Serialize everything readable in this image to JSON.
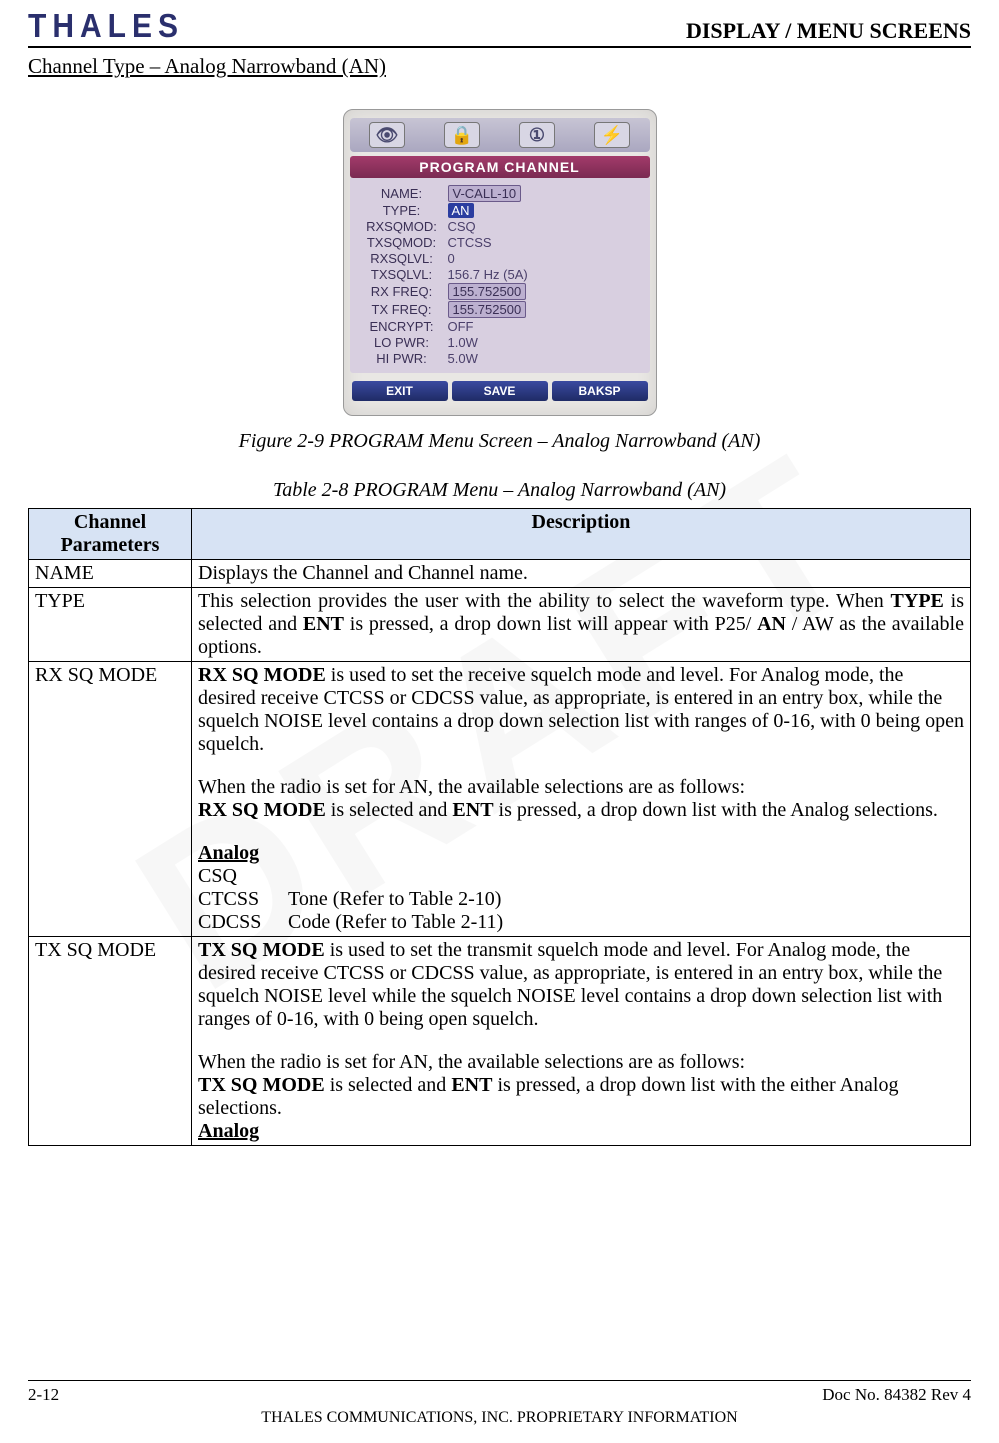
{
  "header": {
    "brand": "THALES",
    "right": "DISPLAY / MENU SCREENS"
  },
  "section_title": "Channel Type – Analog Narrowband (AN)",
  "device": {
    "title": "PROGRAM CHANNEL",
    "iconbar": [
      "👁",
      "🔒",
      "①",
      "⚡"
    ],
    "rows": [
      {
        "label": "NAME:",
        "value": "V-CALL-10",
        "boxed": true
      },
      {
        "label": "TYPE:",
        "value": "AN",
        "selected": true
      },
      {
        "label": "RXSQMOD:",
        "value": "CSQ"
      },
      {
        "label": "TXSQMOD:",
        "value": "CTCSS"
      },
      {
        "label": "RXSQLVL:",
        "value": "0"
      },
      {
        "label": "TXSQLVL:",
        "value": "156.7 Hz (5A)"
      },
      {
        "label": "RX FREQ:",
        "value": "155.752500",
        "boxed": true
      },
      {
        "label": "TX FREQ:",
        "value": "155.752500",
        "boxed": true
      },
      {
        "label": "ENCRYPT:",
        "value": "OFF"
      },
      {
        "label": "LO PWR:",
        "value": "1.0W"
      },
      {
        "label": "HI PWR:",
        "value": "5.0W"
      }
    ],
    "buttons": [
      "EXIT",
      "SAVE",
      "BAKSP"
    ]
  },
  "figure_caption": "Figure 2-9 PROGRAM Menu Screen – Analog Narrowband (AN)",
  "table_caption": "Table 2-8 PROGRAM Menu – Analog Narrowband (AN)",
  "table": {
    "col1": "Channel Parameters",
    "col2": "Description",
    "rows": {
      "name": {
        "param": "NAME",
        "desc": "Displays the Channel and Channel name."
      },
      "type": {
        "param": "TYPE",
        "l1a": "This selection provides the user with the ability to select the waveform type.  When ",
        "l1b": "TYPE",
        "l1c": " is selected and ",
        "l1d": "ENT",
        "l1e": " is pressed, a drop down list will appear with P25/ ",
        "l1f": "AN",
        "l1g": " / AW as the available options."
      },
      "rxsq": {
        "param": "RX SQ MODE",
        "p1a": "RX SQ MODE",
        "p1b": " is used to set the receive squelch mode and level.  For Analog mode, the desired receive CTCSS or CDCSS value, as appropriate, is entered in an entry box, while the squelch NOISE level contains a drop down selection list with ranges of 0-16, with 0 being open squelch.",
        "p2": "When the radio is set for AN, the available selections are as follows:",
        "p3a": "RX SQ MODE",
        "p3b": " is selected and ",
        "p3c": "ENT",
        "p3d": " is pressed, a drop down list with the Analog selections.",
        "analog_h": "Analog",
        "a1": "CSQ",
        "a2a": "CTCSS",
        "a2b": "Tone (Refer to Table 2-10)",
        "a3a": "CDCSS",
        "a3b": "Code (Refer to Table 2-11)"
      },
      "txsq": {
        "param": "TX SQ MODE",
        "p1a": "TX SQ MODE",
        "p1b": " is used to set the transmit squelch mode and level.  For Analog mode, the desired receive CTCSS or CDCSS value, as appropriate, is entered in an entry box, while the squelch NOISE level while the squelch NOISE level contains a drop down selection list with ranges of 0-16, with 0 being open squelch.",
        "p2": "When the radio is set for AN, the available selections are as follows:",
        "p3a": "TX SQ MODE",
        "p3b": " is selected and ",
        "p3c": "ENT",
        "p3d": " is pressed, a drop down list with the either Analog selections.",
        "analog_h": "Analog"
      }
    }
  },
  "footer": {
    "left": "2-12",
    "right": "Doc No. 84382 Rev 4",
    "center": "THALES COMMUNICATIONS, INC. PROPRIETARY INFORMATION"
  },
  "watermark": "DRAFT"
}
